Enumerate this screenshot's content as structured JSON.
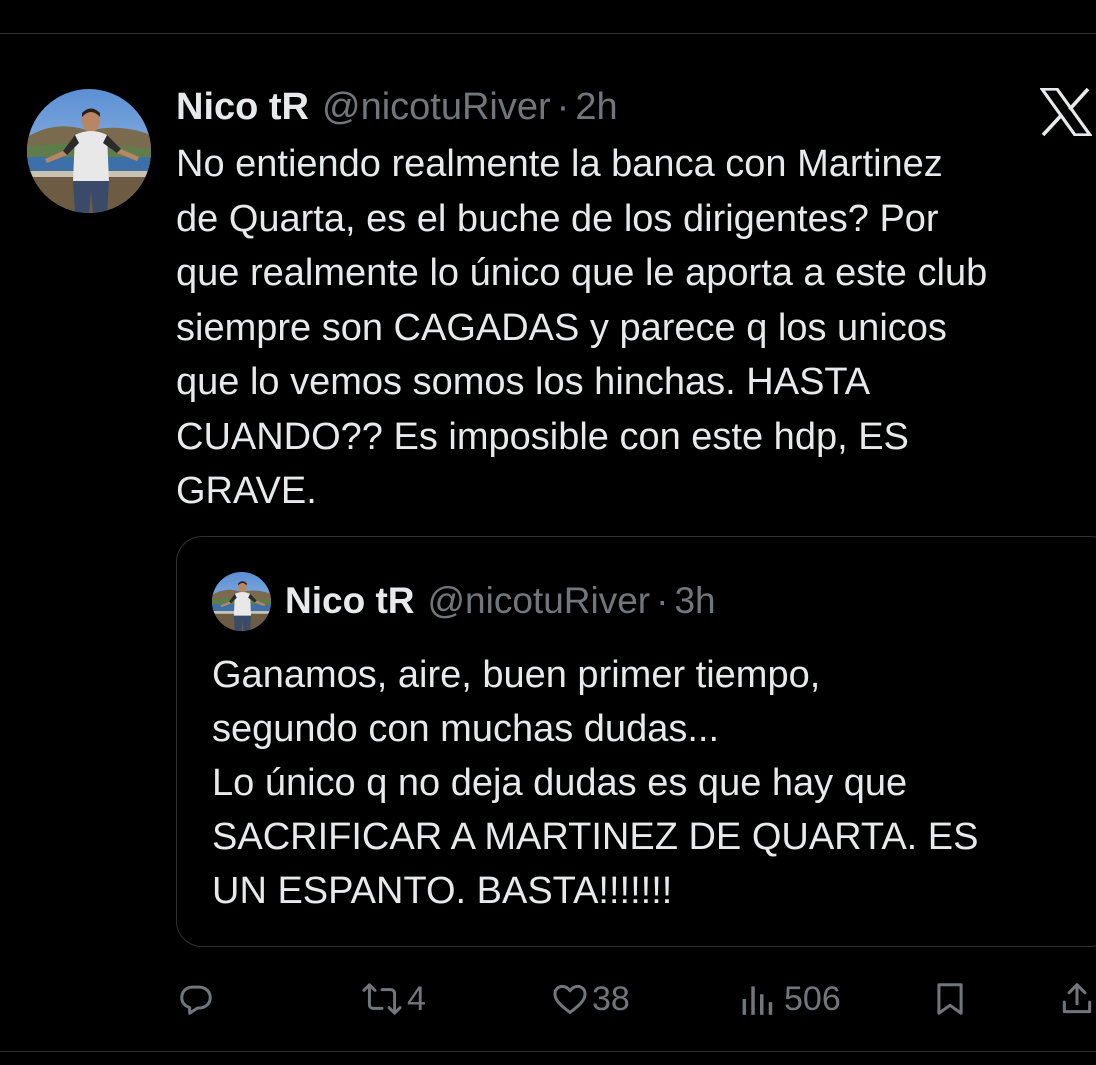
{
  "tweet": {
    "display_name": "Nico tR",
    "handle": "@nicotuRiver",
    "separator": "·",
    "time": "2h",
    "text": "No entiendo realmente la banca con Martinez\nde Quarta, es el buche de los dirigentes? Por\nque realmente lo único que le aporta a este club\nsiempre son CAGADAS y parece q los unicos\nque lo vemos somos los hinchas. HASTA\nCUANDO?? Es imposible con este hdp, ES\nGRAVE."
  },
  "quoted_tweet": {
    "display_name": "Nico tR",
    "handle": "@nicotuRiver",
    "separator": "·",
    "time": "3h",
    "text": "Ganamos, aire, buen primer tiempo,\nsegundo con muchas dudas...\nLo único q no deja dudas es que hay que\nSACRIFICAR A MARTINEZ DE QUARTA. ES\nUN ESPANTO. BASTA!!!!!!!"
  },
  "actions": {
    "reply_count": "",
    "retweet_count": "4",
    "like_count": "38",
    "views_count": "506"
  },
  "icons": {
    "logo": "x-logo-icon",
    "reply": "reply-icon",
    "retweet": "retweet-icon",
    "like": "heart-icon",
    "views": "views-icon",
    "bookmark": "bookmark-icon",
    "share": "share-icon"
  },
  "colors": {
    "background": "#000000",
    "text_primary": "#e7e9ea",
    "text_secondary": "#71767b",
    "border": "#2f3336"
  }
}
